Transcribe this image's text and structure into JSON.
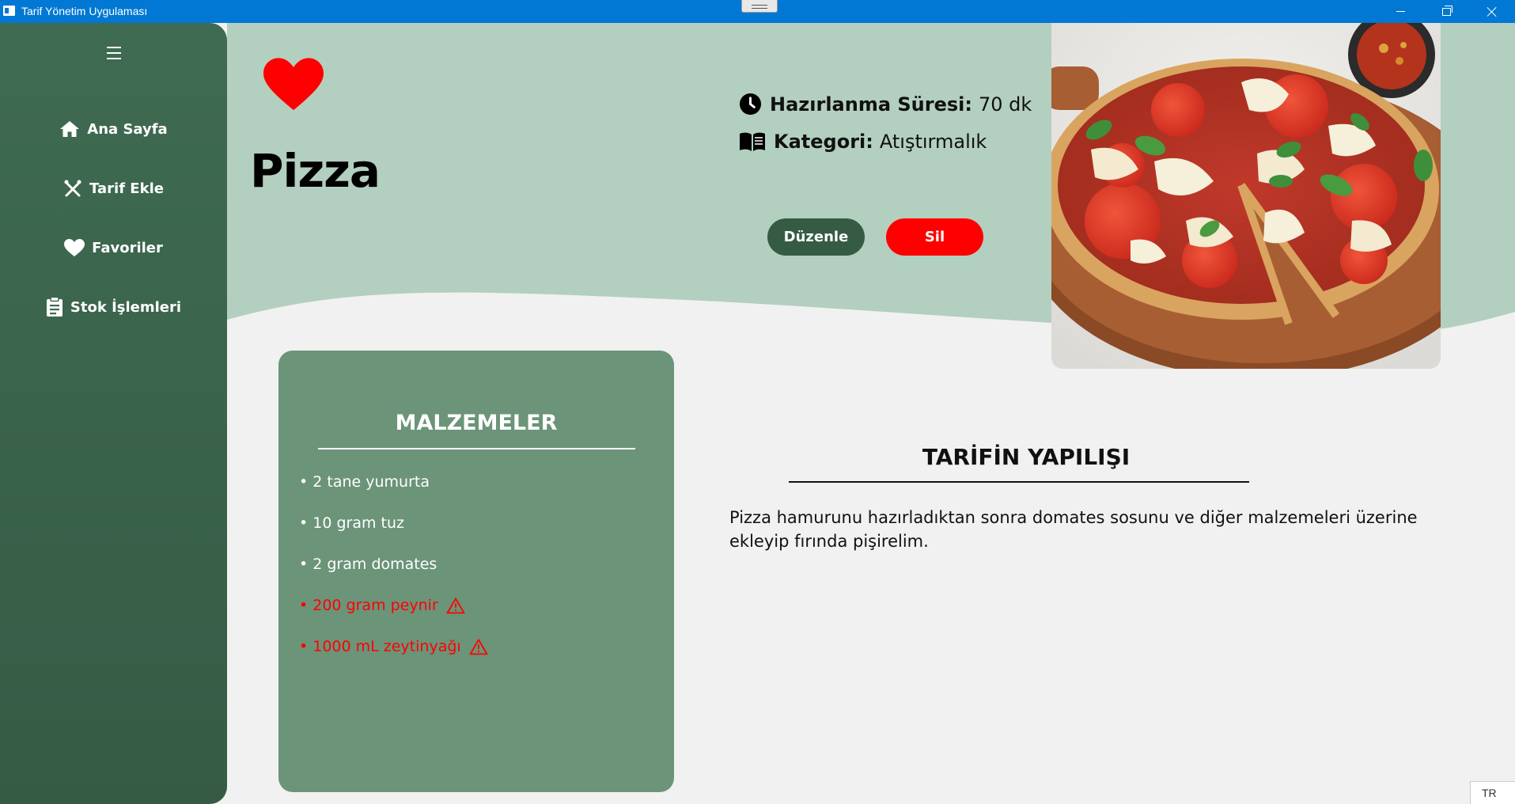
{
  "window": {
    "title": "Tarif Yönetim Uygulaması"
  },
  "sidebar": {
    "items": [
      {
        "label": "Ana Sayfa",
        "icon": "home-icon"
      },
      {
        "label": "Tarif Ekle",
        "icon": "utensils-icon"
      },
      {
        "label": "Favoriler",
        "icon": "heart-icon"
      },
      {
        "label": "Stok İşlemleri",
        "icon": "clipboard-icon"
      }
    ]
  },
  "recipe": {
    "name": "Pizza",
    "favorite": true,
    "prep_time_label": "Hazırlanma Süresi:",
    "prep_time_value": "70 dk",
    "category_label": "Kategori:",
    "category_value": "Atıştırmalık",
    "edit_label": "Düzenle",
    "delete_label": "Sil"
  },
  "ingredients": {
    "title": "MALZEMELER",
    "items": [
      {
        "text": "• 2 tane yumurta",
        "missing": false
      },
      {
        "text": "• 10 gram tuz",
        "missing": false
      },
      {
        "text": "• 2 gram domates",
        "missing": false
      },
      {
        "text": "• 200 gram peynir",
        "missing": true
      },
      {
        "text": "• 1000 mL zeytinyağı",
        "missing": true
      }
    ]
  },
  "instructions": {
    "title": "TARİFİN YAPILIŞI",
    "text": "Pizza hamurunu hazırladıktan sonra domates sosunu ve diğer malzemeleri üzerine ekleyip fırında pişirelim."
  },
  "taskbar": {
    "language": "TR"
  },
  "colors": {
    "sidebar": "#3f6b52",
    "header": "#b3cfbf",
    "card": "#6b9479",
    "accent_red": "#ff0000",
    "edit_button": "#355b45",
    "titlebar": "#0078d4"
  }
}
